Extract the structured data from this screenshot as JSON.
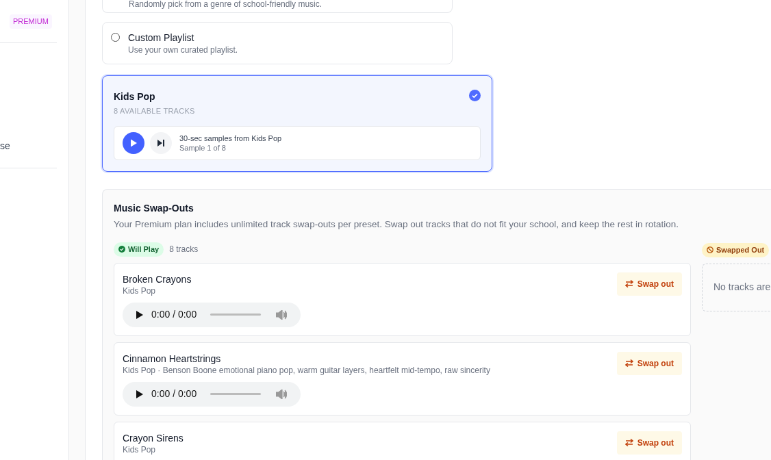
{
  "sidebar": {
    "badge": "PREMIUM",
    "items": [
      {
        "label": "se"
      }
    ]
  },
  "options": [
    {
      "description": "Randomly pick from a genre of school-friendly music."
    },
    {
      "title": "Custom Playlist",
      "description": "Use your own curated playlist.",
      "selected": false
    }
  ],
  "genre": {
    "title": "Kids Pop",
    "subtitle": "8 AVAILABLE TRACKS",
    "selected": true,
    "sampler": {
      "title": "30-sec samples from Kids Pop",
      "subtitle": "Sample 1 of 8"
    }
  },
  "swap_outs": {
    "title": "Music Swap-Outs",
    "description": "Your Premium plan includes unlimited track swap-outs per preset. Swap out tracks that do not fit your school, and keep the rest in rotation.",
    "will_play": {
      "badge": "Will Play",
      "count": "8 tracks"
    },
    "tracks": [
      {
        "title": "Broken Crayons",
        "meta": "Kids Pop",
        "time": "0:00 / 0:00",
        "button": "Swap out"
      },
      {
        "title": "Cinnamon Heartstrings",
        "meta": "Kids Pop · Benson Boone emotional piano pop, warm guitar layers, heartfelt mid-tempo, raw sincerity",
        "time": "0:00 / 0:00",
        "button": "Swap out"
      },
      {
        "title": "Crayon Sirens",
        "meta": "Kids Pop",
        "button": "Swap out"
      }
    ],
    "swapped_out": {
      "badge": "Swapped Out",
      "empty": "No tracks are"
    }
  }
}
